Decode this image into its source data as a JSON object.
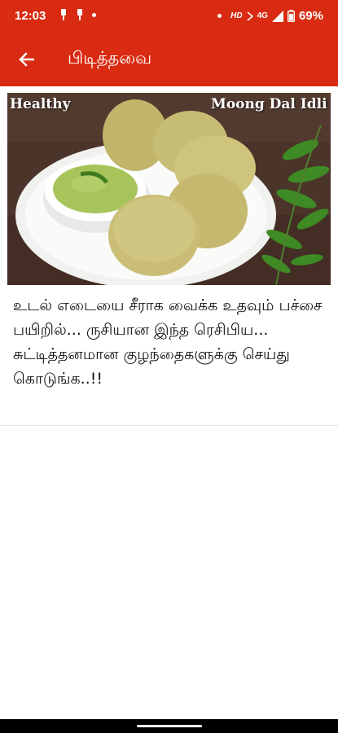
{
  "status_bar": {
    "time": "12:03",
    "hd": "HD",
    "network": "4G",
    "battery": "69%"
  },
  "app_bar": {
    "title": "பிடித்தவை",
    "back_icon": "arrow-back-icon"
  },
  "card": {
    "image_caption_left": "Healthy",
    "image_caption_right": "Moong Dal Idli",
    "description": "உடல் எடையை சீராக வைக்க உதவும் பச்சை பயிறில்... ருசியான இந்த ரெசிபிய... சுட்டித்தனமான குழந்தைகளுக்கு செய்து கொடுங்க..!!"
  },
  "colors": {
    "primary": "#d92b12",
    "text": "#111111"
  }
}
